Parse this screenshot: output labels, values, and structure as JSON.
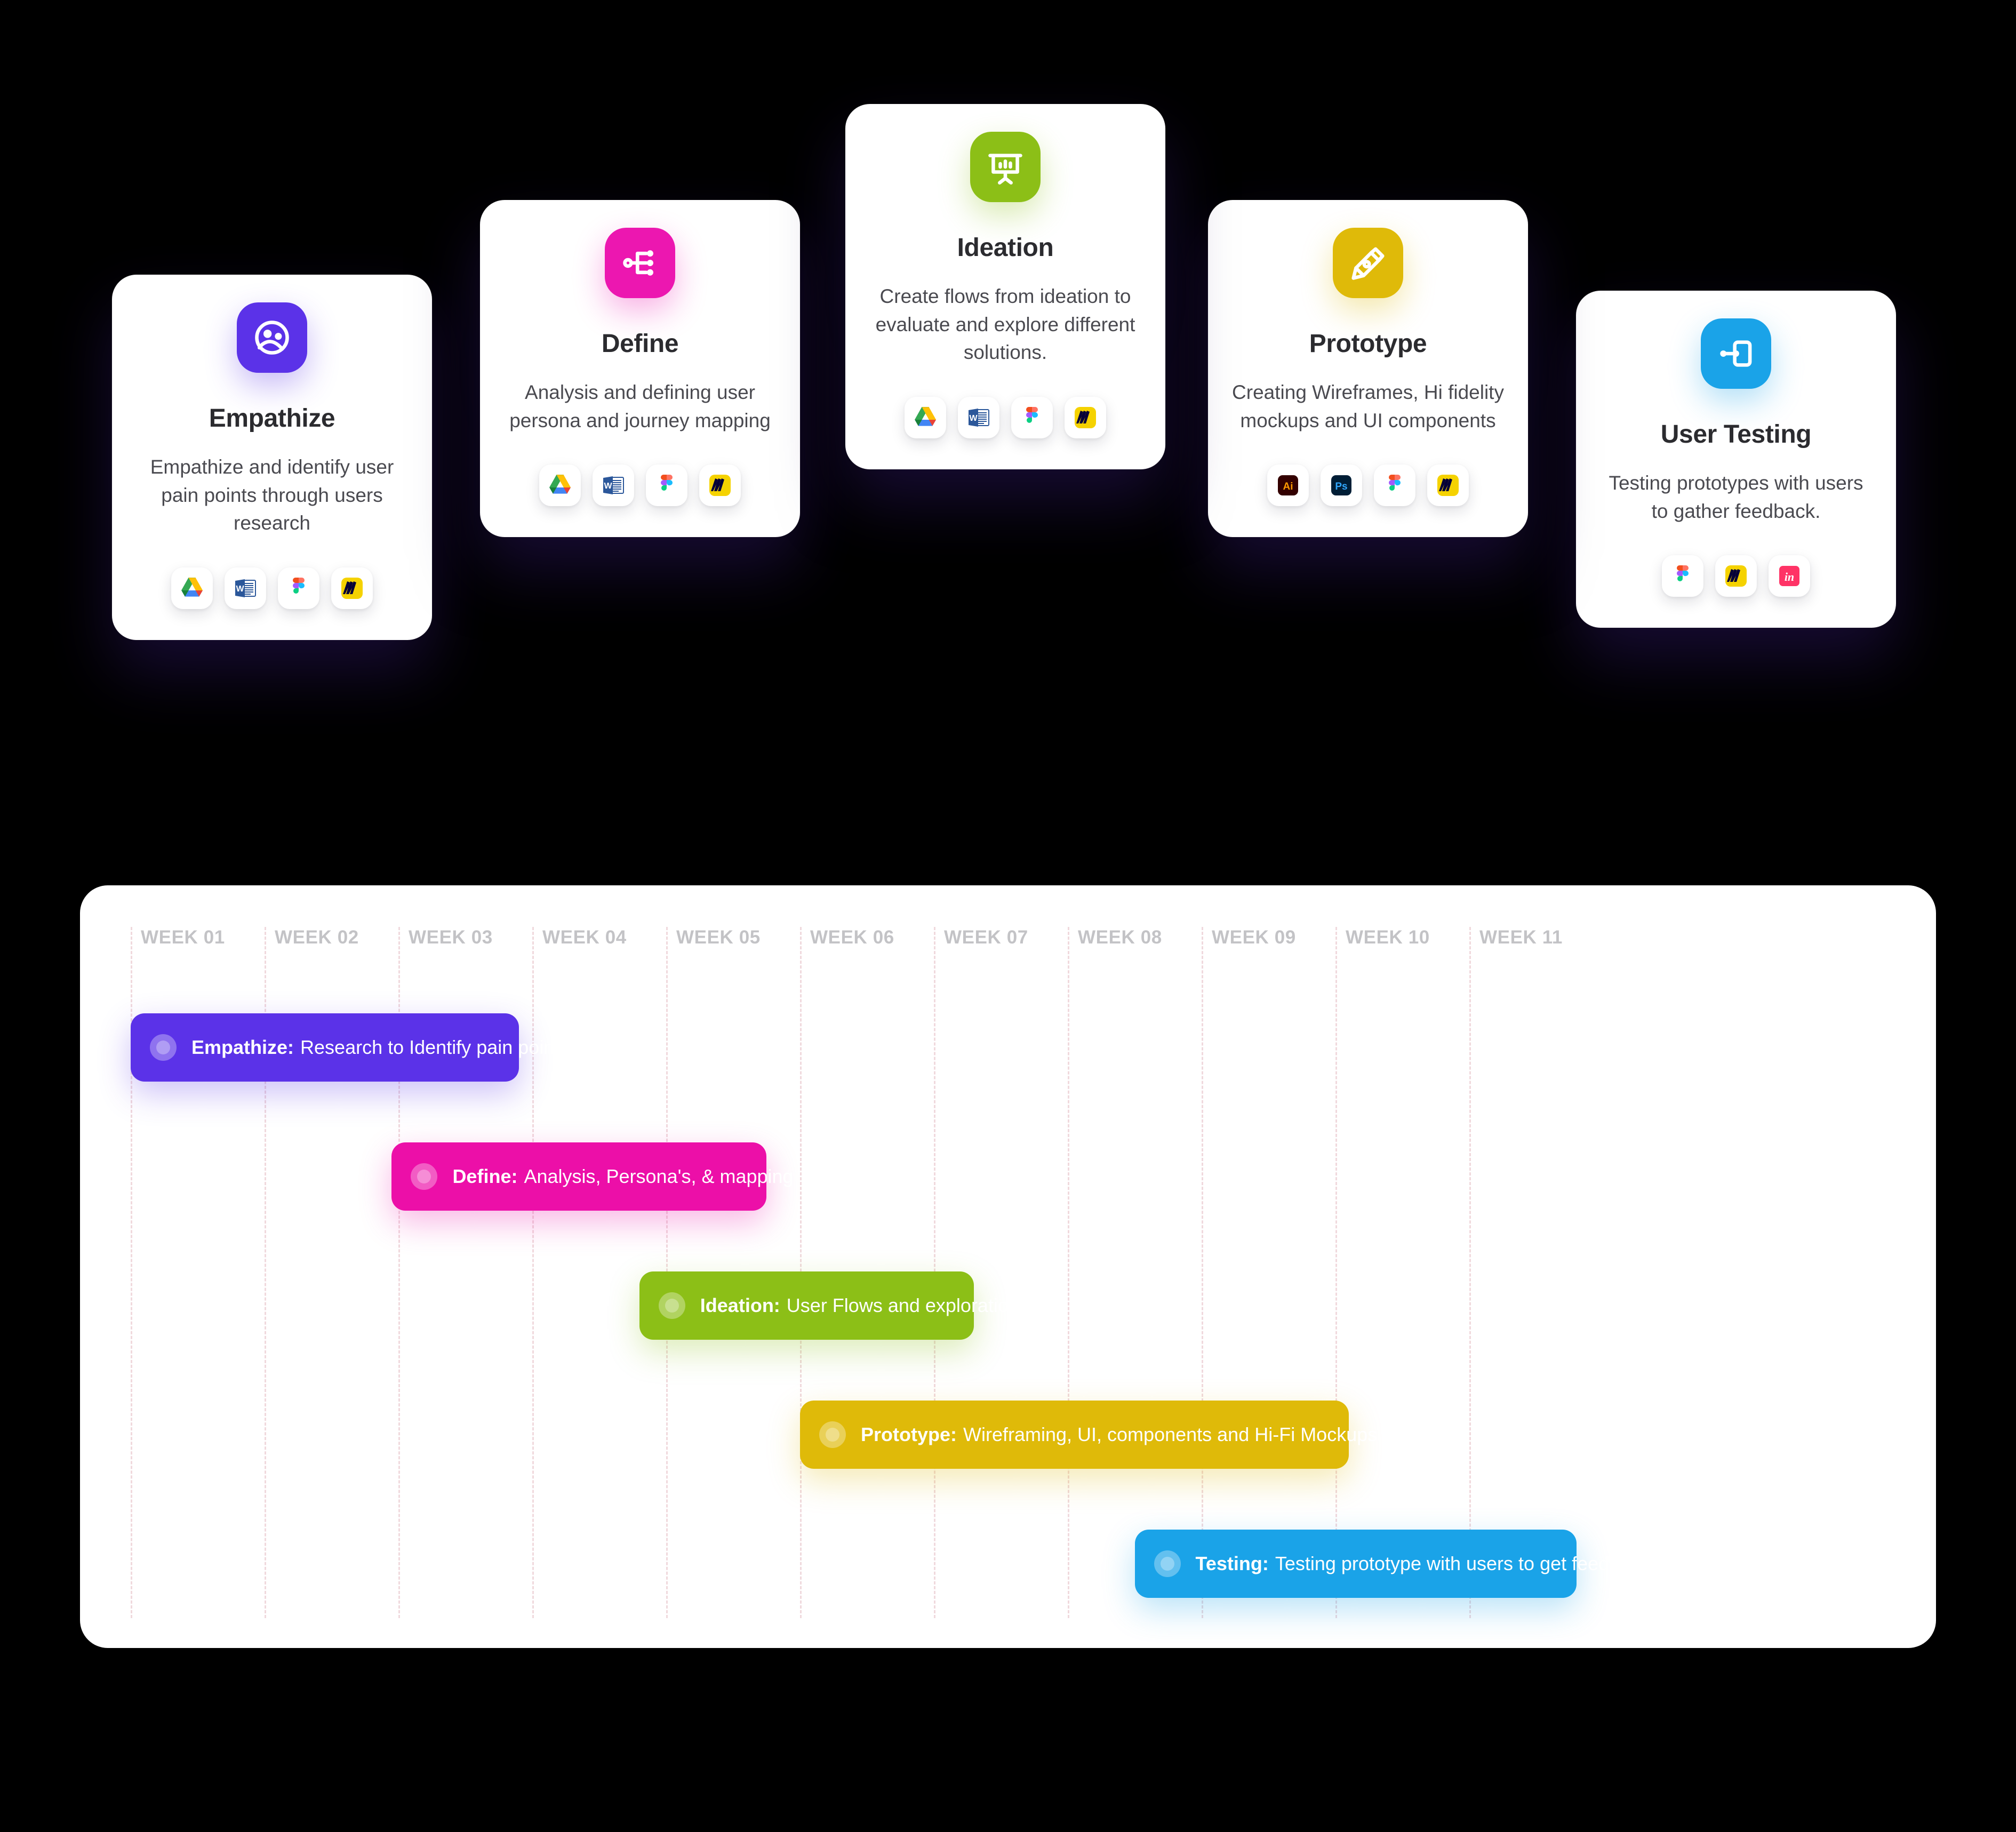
{
  "cards": [
    {
      "id": "empathize",
      "title": "Empathize",
      "description": "Empathize and identify user pain points through users research",
      "icon_name": "empathize-people-icon",
      "accent": "#5B32E8",
      "tools": [
        "google-drive",
        "ms-word",
        "figma",
        "miro"
      ]
    },
    {
      "id": "define",
      "title": "Define",
      "description": "Analysis and defining user persona and journey mapping",
      "icon_name": "sitemap-branching-icon",
      "accent": "#EC17B0",
      "tools": [
        "google-drive",
        "ms-word",
        "figma",
        "miro"
      ]
    },
    {
      "id": "ideation",
      "title": "Ideation",
      "description": "Create flows from ideation to evaluate and explore different solutions.",
      "icon_name": "presentation-board-icon",
      "accent": "#8CBF17",
      "tools": [
        "google-drive",
        "ms-word",
        "figma",
        "miro"
      ]
    },
    {
      "id": "prototype",
      "title": "Prototype",
      "description": "Creating Wireframes, Hi fidelity mockups and UI components",
      "icon_name": "pen-nib-icon",
      "accent": "#DFBA09",
      "tools": [
        "adobe-illustrator",
        "adobe-photoshop",
        "figma",
        "miro"
      ]
    },
    {
      "id": "user-testing",
      "title": "User Testing",
      "description": "Testing prototypes with users to gather feedback.",
      "icon_name": "prototype-link-icon",
      "accent": "#1AA3E8",
      "tools": [
        "figma",
        "miro",
        "invision"
      ]
    }
  ],
  "chart_data": {
    "type": "bar",
    "title": "",
    "xlabel": "",
    "ylabel": "",
    "orientation": "horizontal-gantt",
    "grid": true,
    "legend": "none",
    "categories": [
      "WEEK 01",
      "WEEK 02",
      "WEEK 03",
      "WEEK 04",
      "WEEK 05",
      "WEEK 06",
      "WEEK 07",
      "WEEK 08",
      "WEEK 09",
      "WEEK 10",
      "WEEK 11"
    ],
    "xlim": [
      1,
      12
    ],
    "series": [
      {
        "name": "Empathize",
        "phase": "Empathize:",
        "task": "Research to Identify pain points",
        "color": "#5B32E8",
        "start_week": 1,
        "end_week": 3.9,
        "duration_weeks": 2.9
      },
      {
        "name": "Define",
        "phase": "Define:",
        "task": "Analysis, Persona's, & mapping",
        "color": "#EC0FA8",
        "start_week": 2.95,
        "end_week": 5.75,
        "duration_weeks": 2.8
      },
      {
        "name": "Ideation",
        "phase": "Ideation:",
        "task": "User Flows and exploration",
        "color": "#8CBF17",
        "start_week": 4.8,
        "end_week": 7.3,
        "duration_weeks": 2.5
      },
      {
        "name": "Prototype",
        "phase": "Prototype:",
        "task": "Wireframing, UI, components and Hi-Fi Mockups",
        "color": "#DFBA09",
        "start_week": 6.0,
        "end_week": 10.1,
        "duration_weeks": 4.1
      },
      {
        "name": "Testing",
        "phase": "Testing:",
        "task": "Testing prototype with users to get feedback",
        "color": "#1AA3E8",
        "start_week": 8.5,
        "end_week": 11.8,
        "duration_weeks": 3.3
      }
    ]
  }
}
